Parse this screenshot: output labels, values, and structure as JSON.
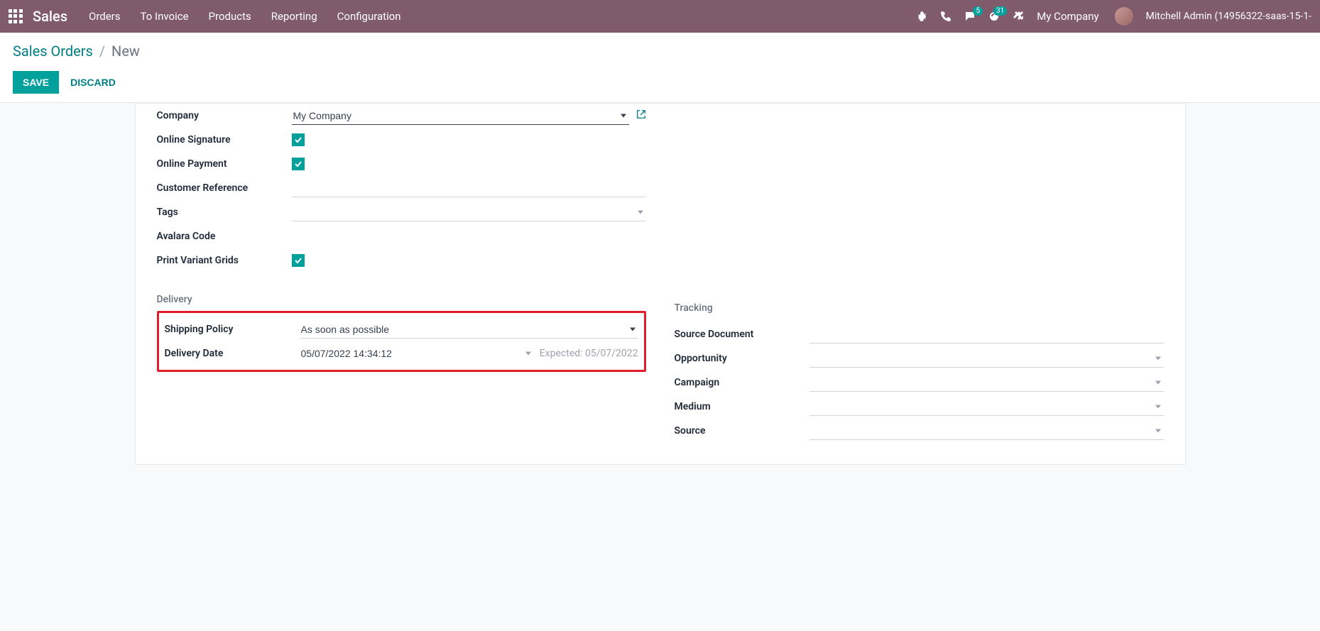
{
  "nav": {
    "brand": "Sales",
    "links": [
      "Orders",
      "To Invoice",
      "Products",
      "Reporting",
      "Configuration"
    ],
    "messages_badge": "5",
    "activities_badge": "31",
    "company": "My Company",
    "user": "Mitchell Admin (14956322-saas-15-1-"
  },
  "breadcrumb": {
    "root": "Sales Orders",
    "current": "New"
  },
  "buttons": {
    "save": "SAVE",
    "discard": "DISCARD"
  },
  "form": {
    "company_label": "Company",
    "company_value": "My Company",
    "online_signature_label": "Online Signature",
    "online_payment_label": "Online Payment",
    "customer_ref_label": "Customer Reference",
    "customer_ref_value": "",
    "tags_label": "Tags",
    "tags_value": "",
    "avalara_label": "Avalara Code",
    "print_variant_label": "Print Variant Grids",
    "delivery_title": "Delivery",
    "shipping_policy_label": "Shipping Policy",
    "shipping_policy_value": "As soon as possible",
    "delivery_date_label": "Delivery Date",
    "delivery_date_value": "05/07/2022 14:34:12",
    "expected_text": "Expected: 05/07/2022",
    "tracking_title": "Tracking",
    "source_doc_label": "Source Document",
    "opportunity_label": "Opportunity",
    "campaign_label": "Campaign",
    "medium_label": "Medium",
    "source_label": "Source"
  }
}
